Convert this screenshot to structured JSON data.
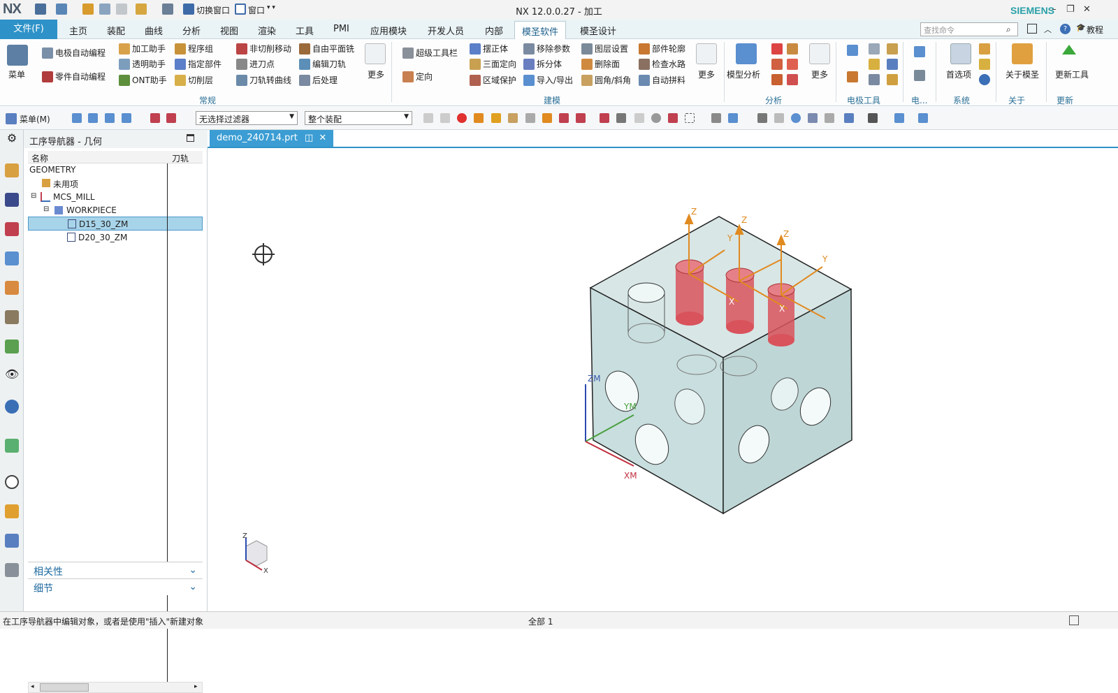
{
  "app": {
    "logo": "NX",
    "title": "NX 12.0.0.27 - 加工",
    "brand": "SIEMENS"
  },
  "quick_access": {
    "switch_window": "切换窗口",
    "window": "窗口"
  },
  "tabs": {
    "file": "文件(F)",
    "items": [
      "主页",
      "装配",
      "曲线",
      "分析",
      "视图",
      "渲染",
      "工具",
      "PMI",
      "应用模块",
      "开发人员",
      "内部",
      "模圣软件",
      "模圣设计"
    ],
    "active": "模圣软件"
  },
  "search": {
    "placeholder": "查找命令",
    "tutorial": "教程"
  },
  "ribbon": {
    "menu": "菜单",
    "common": [
      "电极自动编程",
      "零件自动编程",
      "加工助手",
      "透明助手",
      "ONT助手",
      "程序组",
      "指定部件",
      "切削层",
      "非切削移动",
      "进刀点",
      "刀轨转曲线",
      "自由平面铣",
      "编辑刀轨",
      "后处理"
    ],
    "more": "更多",
    "group_common": "常规",
    "modeling": [
      "超级工具栏",
      "定向",
      "摆正体",
      "三面定向",
      "区域保护",
      "移除参数",
      "拆分体",
      "导入/导出",
      "图层设置",
      "删除面",
      "圆角/斜角",
      "部件轮廓",
      "检查水路",
      "自动拼料"
    ],
    "group_modeling": "建模",
    "model_analysis": "模型分析",
    "group_analysis": "分析",
    "group_electrode": "电极工具",
    "group_elec2": "电...",
    "preferences": "首选项",
    "group_system": "系统",
    "about": "关于模圣",
    "group_about": "关于",
    "update_tool": "更新工具",
    "group_update": "更新"
  },
  "toolbar": {
    "menu": "菜单(M)",
    "filter": "无选择过滤器",
    "assembly": "整个装配"
  },
  "navigator": {
    "title": "工序导航器 - 几何",
    "col_name": "名称",
    "col_path": "刀轨",
    "rows": [
      "GEOMETRY",
      "未用项",
      "MCS_MILL",
      "WORKPIECE",
      "D15_30_ZM",
      "D20_30_ZM"
    ],
    "panels": [
      "相关性",
      "细节"
    ]
  },
  "document": {
    "tab": "demo_240714.prt"
  },
  "viewport": {
    "labels": {
      "z": "Z",
      "y": "Y",
      "x": "X",
      "zm": "ZM",
      "ym": "YM",
      "xm": "XM"
    }
  },
  "status": {
    "message": "在工序导航器中编辑对象，或者是使用\"插入\"新建对象",
    "count": "全部 1"
  },
  "colors": {
    "accent": "#2e92c8",
    "hole": "#d9535c",
    "block": "#c9dede"
  }
}
